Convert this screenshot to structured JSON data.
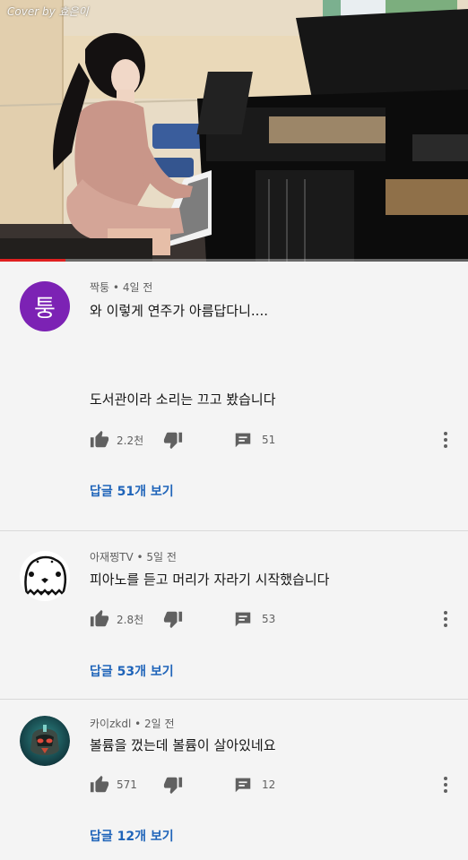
{
  "video": {
    "watermark": "Cover by 효은이",
    "progress_fraction": 0.14,
    "progress_color": "#e02020"
  },
  "comments": [
    {
      "avatar_letter": "퉁",
      "avatar_color": "#7c22b4",
      "author": "짝퉁",
      "time": "4일 전",
      "text_lines": [
        "와 이렇게 연주가 아름답다니....",
        "도서관이라 소리는 끄고 봤습니다"
      ],
      "likes": "2.2천",
      "replies": "51",
      "view_replies": "답글 51개 보기"
    },
    {
      "avatar_icon": "ghost-face-icon",
      "author": "아재찡TV",
      "time": "5일 전",
      "text_lines": [
        "피아노를 듣고 머리가 자라기 시작했습니다"
      ],
      "likes": "2.8천",
      "replies": "53",
      "view_replies": "답글 53개 보기"
    },
    {
      "avatar_icon": "robot-helmet-icon",
      "author": "카이zkdl",
      "time": "2일 전",
      "text_lines": [
        "볼륨을 껐는데 볼륨이 살아있네요"
      ],
      "likes": "571",
      "replies": "12",
      "view_replies": "답글 12개 보기"
    }
  ],
  "meta_separator": " • ",
  "colors": {
    "background": "#f4f4f4",
    "link": "#1f64b9",
    "secondary_text": "#606060"
  }
}
